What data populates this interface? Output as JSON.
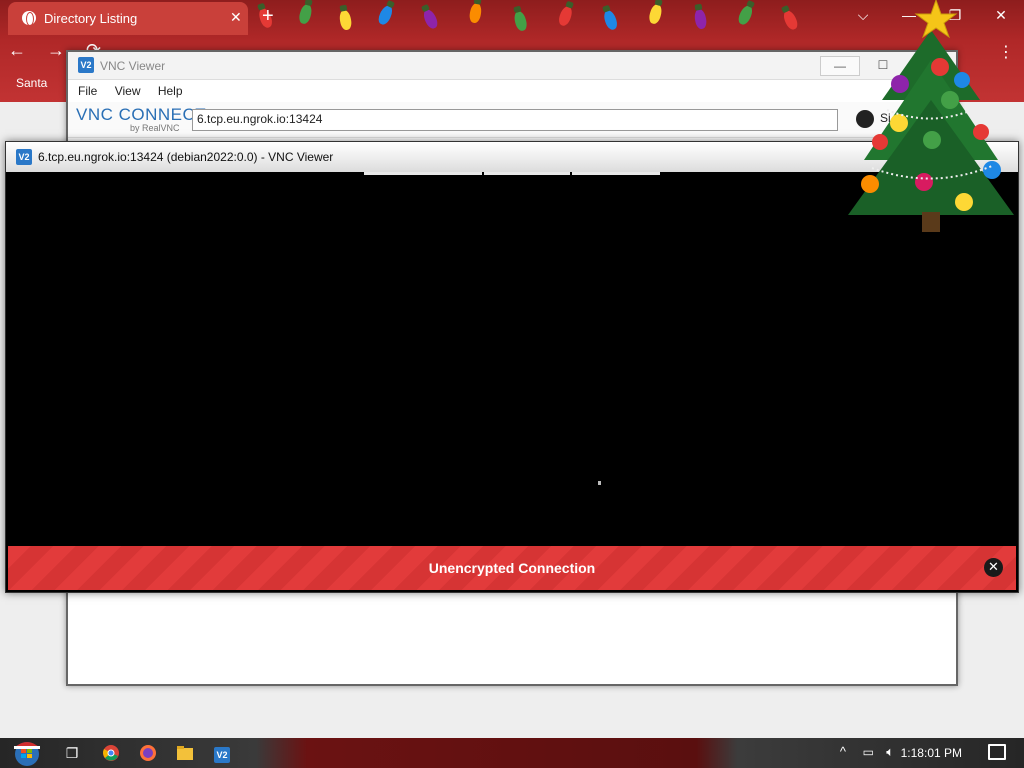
{
  "browser": {
    "tab_title": "Directory Listing",
    "tab_close": "✕",
    "new_tab": "+",
    "bookmark": "Santa",
    "window_controls": [
      "⌵",
      "—",
      "❐",
      "✕"
    ],
    "nav": [
      "←",
      "→",
      "⟳"
    ],
    "menu": "⋮"
  },
  "vnc_main": {
    "title": "VNC Viewer",
    "menu": [
      "File",
      "View",
      "Help"
    ],
    "brand": "VNC CONNECT",
    "brand_sub": "by RealVNC",
    "address_value": "6.tcp.eu.ngrok.io:13424",
    "signin_label": "Si",
    "minimize": "—",
    "maximize": "☐"
  },
  "vnc_session": {
    "title": "6.tcp.eu.ngrok.io:13424 (debian2022:0.0) - VNC Viewer",
    "banner_text": "Unencrypted Connection",
    "banner_close": "✕"
  },
  "taskbar": {
    "clock": "1:18:01 PM",
    "tray_up": "^",
    "vnc_label": "V2"
  },
  "colors": {
    "browser_red": "#c23333",
    "banner_red": "#e23b3b",
    "vnc_blue": "#2a78c8"
  }
}
